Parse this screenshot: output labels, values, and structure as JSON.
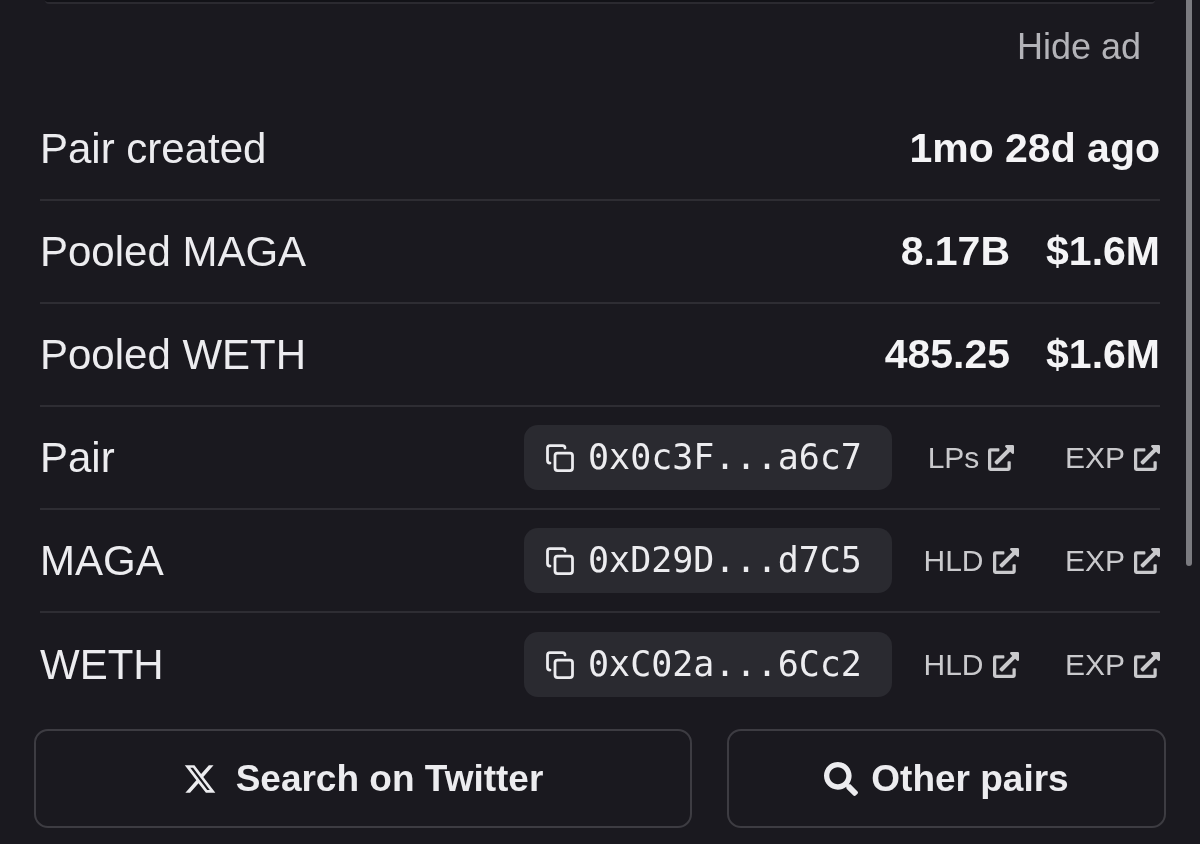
{
  "ad": {
    "hide_label": "Hide ad"
  },
  "rows": [
    {
      "kind": "value",
      "label": "Pair created",
      "values": [
        "1mo 28d ago"
      ]
    },
    {
      "kind": "value",
      "label": "Pooled MAGA",
      "values": [
        "8.17B",
        "$1.6M"
      ]
    },
    {
      "kind": "value",
      "label": "Pooled WETH",
      "values": [
        "485.25",
        "$1.6M"
      ]
    },
    {
      "kind": "address",
      "label": "Pair",
      "address": "0x0c3F...a6c7",
      "links": [
        "LPs",
        "EXP"
      ]
    },
    {
      "kind": "address",
      "label": "MAGA",
      "address": "0xD29D...d7C5",
      "links": [
        "HLD",
        "EXP"
      ]
    },
    {
      "kind": "address",
      "label": "WETH",
      "address": "0xC02a...6Cc2",
      "links": [
        "HLD",
        "EXP"
      ]
    }
  ],
  "buttons": [
    {
      "kind": "twitter",
      "label": "Search on Twitter"
    },
    {
      "kind": "search",
      "label": "Other pairs"
    }
  ]
}
